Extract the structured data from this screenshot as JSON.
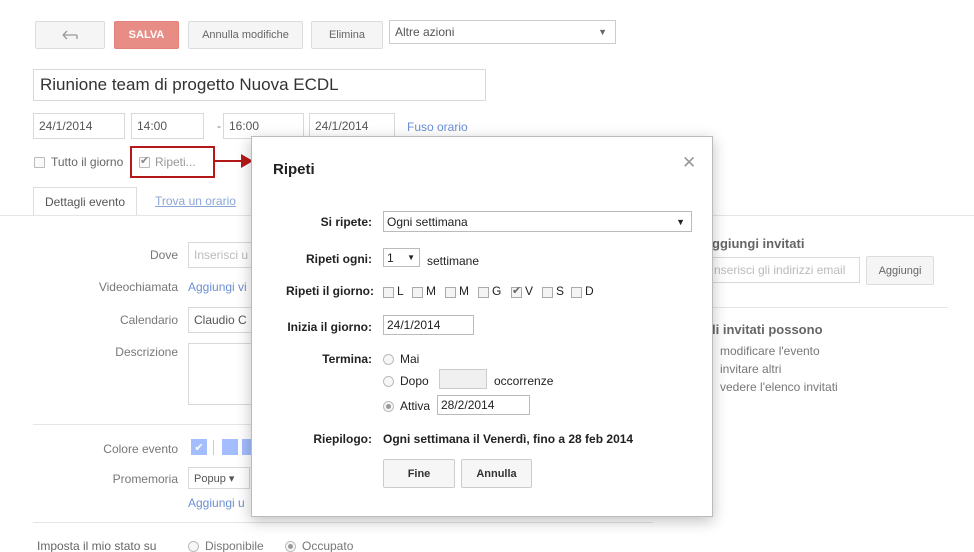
{
  "toolbar": {
    "back_icon": "back-arrow-icon",
    "save_label": "SALVA",
    "discard_label": "Annulla modifiche",
    "delete_label": "Elimina",
    "more_actions": "Altre azioni"
  },
  "event": {
    "title": "Riunione team di progetto Nuova ECDL",
    "start_date": "24/1/2014",
    "start_time": "14:00",
    "dash": "-",
    "end_time": "16:00",
    "end_date": "24/1/2014",
    "timezone_link": "Fuso orario",
    "all_day_label": "Tutto il giorno",
    "repeat_label": "Ripeti...",
    "repeat_checked": true
  },
  "tabs": [
    {
      "label": "Dettagli evento"
    },
    {
      "label": "Trova un orario"
    }
  ],
  "details": {
    "where_label": "Dove",
    "where_placeholder": "Inserisci u",
    "video_label": "Videochiamata",
    "video_link": "Aggiungi vi",
    "calendar_label": "Calendario",
    "calendar_value": "Claudio C",
    "description_label": "Descrizione",
    "color_label": "Colore evento",
    "reminder_label": "Promemoria",
    "reminder_value": "Popup ▾",
    "reminder_add_link": "Aggiungi u",
    "status_label": "Imposta il mio stato su",
    "status_available": "Disponibile",
    "status_busy": "Occupato",
    "colors": [
      "#a4bdfc",
      "#a4bdfc",
      "#a4bdfc"
    ]
  },
  "guests": {
    "title": "ggiungi invitati",
    "input_placeholder": "nserisci gli indirizzi email",
    "add_button": "Aggiungi",
    "can_title": "li invitati possono",
    "options": [
      "modificare l'evento",
      "invitare altri",
      "vedere l'elenco invitati"
    ]
  },
  "dialog": {
    "title": "Ripeti",
    "close_icon": "close-icon",
    "repeats_label": "Si ripete:",
    "repeats_value": "Ogni settimana",
    "every_label": "Ripeti ogni:",
    "every_value": "1",
    "every_unit": "settimane",
    "on_label": "Ripeti il giorno:",
    "days": [
      {
        "label": "L",
        "checked": false
      },
      {
        "label": "M",
        "checked": false
      },
      {
        "label": "M",
        "checked": false
      },
      {
        "label": "G",
        "checked": false
      },
      {
        "label": "V",
        "checked": true
      },
      {
        "label": "S",
        "checked": false
      },
      {
        "label": "D",
        "checked": false
      }
    ],
    "start_label": "Inizia il giorno:",
    "start_value": "24/1/2014",
    "ends_label": "Termina:",
    "end_never": "Mai",
    "end_after": "Dopo",
    "end_after_value": "",
    "end_after_unit": "occorrenze",
    "end_on": "Attiva",
    "end_on_value": "28/2/2014",
    "summary_label": "Riepilogo:",
    "summary_value": "Ogni settimana il Venerdì, fino a 28 feb 2014",
    "done_button": "Fine",
    "cancel_button": "Annulla"
  },
  "accent": {
    "highlight": "#b51818",
    "save": "#e88d86",
    "link": "#6a8fd4"
  }
}
